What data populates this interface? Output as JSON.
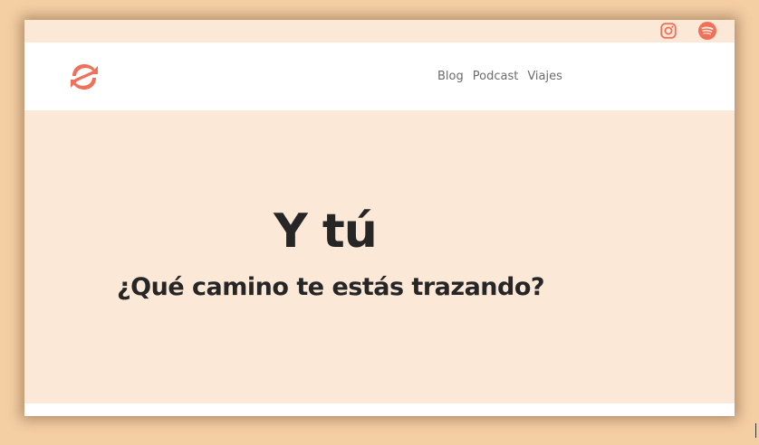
{
  "colors": {
    "page_background": "#f5cfa4",
    "site_background": "#fce8d7",
    "accent": "#f0705a",
    "text_dark": "#262626",
    "nav_text": "#6b6b6b"
  },
  "social": {
    "instagram_icon": "instagram-icon",
    "spotify_icon": "spotify-icon"
  },
  "header": {
    "logo_icon": "brand-logo-icon",
    "nav": [
      {
        "label": "Blog"
      },
      {
        "label": "Podcast"
      },
      {
        "label": "Viajes"
      }
    ]
  },
  "hero": {
    "title": "Y tú",
    "subtitle": "¿Qué camino te estás trazando?"
  }
}
